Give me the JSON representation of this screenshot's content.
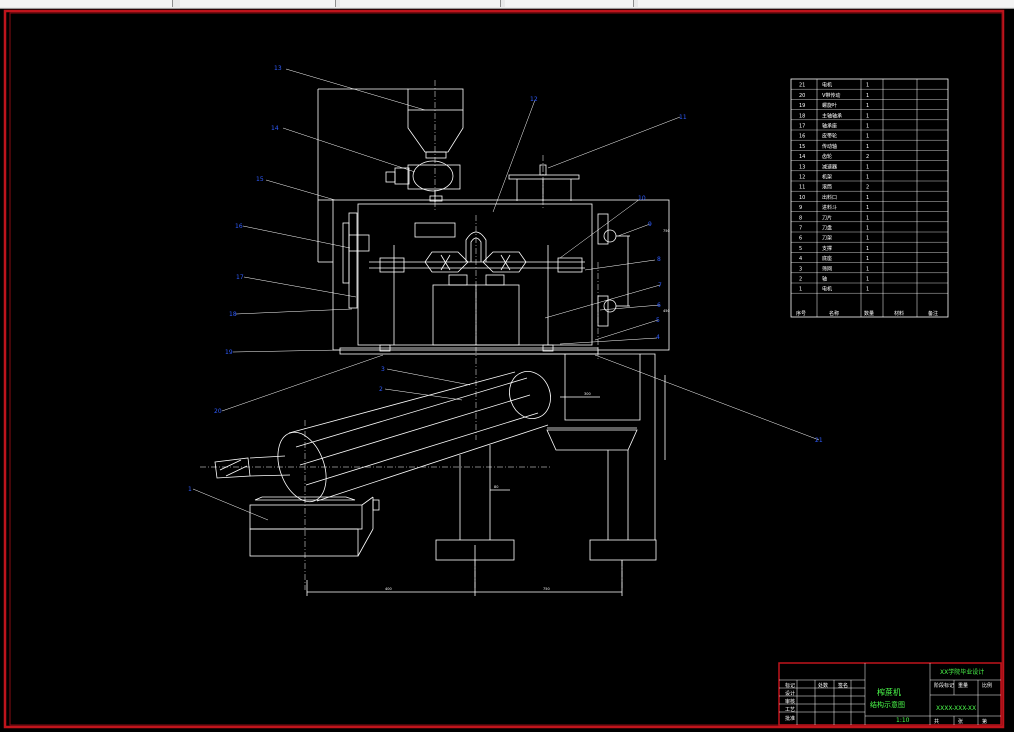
{
  "part_callouts": [
    "1",
    "2",
    "3",
    "4",
    "5",
    "6",
    "7",
    "8",
    "9",
    "10",
    "11",
    "12",
    "13",
    "14",
    "15",
    "16",
    "17",
    "18",
    "19",
    "20",
    "21"
  ],
  "parts_table": {
    "rows": [
      {
        "no": "21",
        "name": "电机",
        "qty": "1"
      },
      {
        "no": "20",
        "name": "V带传动",
        "qty": "1"
      },
      {
        "no": "19",
        "name": "螺旋叶",
        "qty": "1"
      },
      {
        "no": "18",
        "name": "主轴轴承",
        "qty": "1"
      },
      {
        "no": "17",
        "name": "轴承座",
        "qty": "1"
      },
      {
        "no": "16",
        "name": "皮带轮",
        "qty": "1"
      },
      {
        "no": "15",
        "name": "传动轴",
        "qty": "1"
      },
      {
        "no": "14",
        "name": "齿轮",
        "qty": "2"
      },
      {
        "no": "13",
        "name": "减速器",
        "qty": "1"
      },
      {
        "no": "12",
        "name": "机架",
        "qty": "1"
      },
      {
        "no": "11",
        "name": "滚筒",
        "qty": "2"
      },
      {
        "no": "10",
        "name": "出料口",
        "qty": "1"
      },
      {
        "no": "9",
        "name": "进料斗",
        "qty": "1"
      },
      {
        "no": "8",
        "name": "刀片",
        "qty": "1"
      },
      {
        "no": "7",
        "name": "刀盘",
        "qty": "1"
      },
      {
        "no": "6",
        "name": "刀架",
        "qty": "1"
      },
      {
        "no": "5",
        "name": "支撑",
        "qty": "1"
      },
      {
        "no": "4",
        "name": "底座",
        "qty": "1"
      },
      {
        "no": "3",
        "name": "筛网",
        "qty": "1"
      },
      {
        "no": "2",
        "name": "轴",
        "qty": "1"
      },
      {
        "no": "1",
        "name": "电机",
        "qty": "1"
      }
    ],
    "header": {
      "no": "序号",
      "name": "名称",
      "qty": "数量",
      "material": "材料",
      "note": "备注"
    }
  },
  "title_block": {
    "institution": "XX学院毕业设计",
    "drawing_name_line1": "榨蔗机",
    "drawing_name_line2": "结构示意图",
    "scale": "1:10",
    "drawing_no": "XXXX-XXX-XX",
    "left_labels": [
      "标记",
      "设计",
      "审核",
      "工艺",
      "批准"
    ],
    "col_labels": [
      "处数",
      "签名"
    ],
    "right_labels": [
      "阶段标记",
      "重量",
      "比例",
      "共",
      "张",
      "第"
    ]
  },
  "dimensions": {
    "bottom_left": "400",
    "bottom_right": "750",
    "roller_width": "300",
    "shaft_dim": "80",
    "side_a": "750",
    "side_b": "450"
  },
  "colors": {
    "frame": "#c0141c",
    "lines": "#ffffff",
    "callouts": "#2f5cff",
    "title": "#4cff4c"
  }
}
